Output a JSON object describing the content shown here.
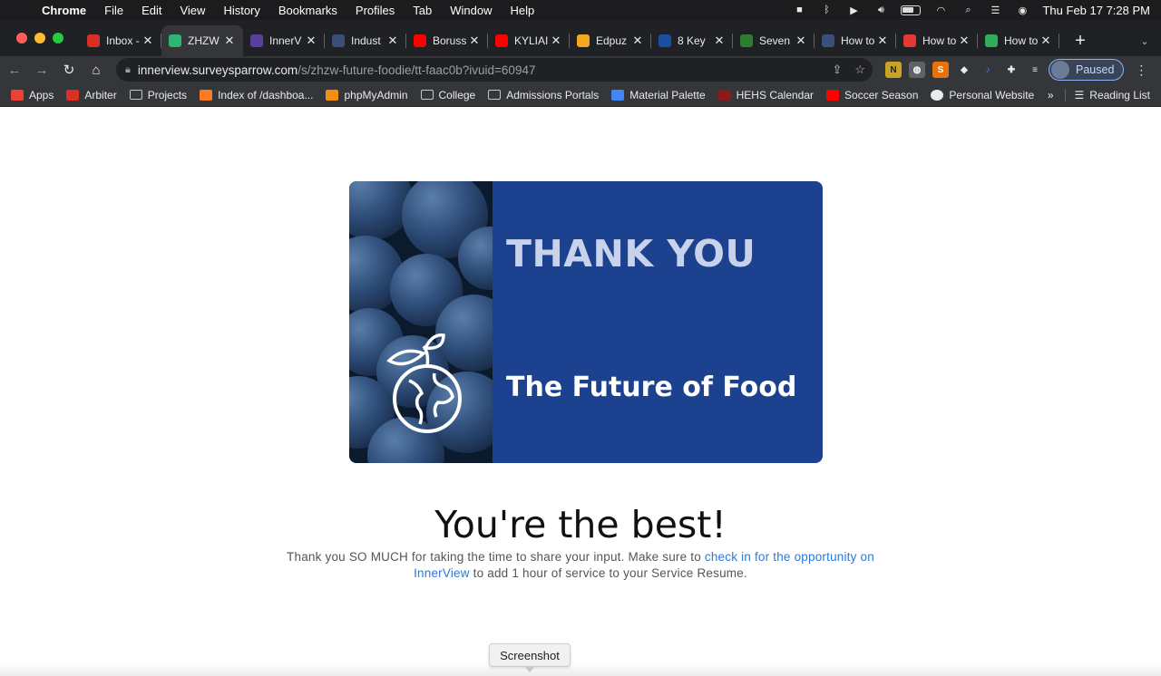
{
  "menubar": {
    "app": "Chrome",
    "items": [
      "File",
      "Edit",
      "View",
      "History",
      "Bookmarks",
      "Profiles",
      "Tab",
      "Window",
      "Help"
    ],
    "clock": "Thu Feb 17  7:28 PM"
  },
  "tabs": [
    {
      "label": "Inbox -",
      "icon": "gmail-icon",
      "color": "#d93025"
    },
    {
      "label": "ZHZW",
      "icon": "surveysparrow-icon",
      "color": "#2bb673",
      "active": true
    },
    {
      "label": "InnerV",
      "icon": "innerview-icon",
      "color": "#5b3fa0"
    },
    {
      "label": "Indust",
      "icon": "swoosh-icon",
      "color": "#3a4f7a"
    },
    {
      "label": "Boruss",
      "icon": "youtube-icon",
      "color": "#ff0000"
    },
    {
      "label": "KYLIAI",
      "icon": "youtube-icon",
      "color": "#ff0000"
    },
    {
      "label": "Edpuz",
      "icon": "edpuzzle-icon",
      "color": "#f5a623"
    },
    {
      "label": "8 Key",
      "icon": "usnews-icon",
      "color": "#1b4ea0"
    },
    {
      "label": "Seven",
      "icon": "mountain-icon",
      "color": "#2e7d32"
    },
    {
      "label": "How to",
      "icon": "swoosh-icon",
      "color": "#3a4f7a"
    },
    {
      "label": "How to",
      "icon": "wave-icon",
      "color": "#e53935"
    },
    {
      "label": "How to",
      "icon": "n-icon",
      "color": "#2fae5a"
    }
  ],
  "toolbar": {
    "url_host": "innerview.surveysparrow.com",
    "url_path": "/s/zhzw-future-foodie/tt-faac0b?ivuid=60947",
    "profile_label": "Paused"
  },
  "bookmarks": [
    {
      "label": "Apps",
      "icon": "apps-grid-icon"
    },
    {
      "label": "Arbiter",
      "icon": "arbiter-icon"
    },
    {
      "label": "Projects",
      "icon": "folder-icon"
    },
    {
      "label": "Index of /dashboa...",
      "icon": "xampp-icon"
    },
    {
      "label": "phpMyAdmin",
      "icon": "phpmyadmin-icon"
    },
    {
      "label": "College",
      "icon": "folder-icon"
    },
    {
      "label": "Admissions Portals",
      "icon": "folder-icon"
    },
    {
      "label": "Material Palette",
      "icon": "palette-icon"
    },
    {
      "label": "HEHS Calendar",
      "icon": "calendar-icon"
    },
    {
      "label": "Soccer Season",
      "icon": "youtube-icon"
    },
    {
      "label": "Personal Website",
      "icon": "globe-icon"
    }
  ],
  "reading_list": "Reading List",
  "hero": {
    "thank_you": "THANK YOU",
    "subtitle": "The Future of Food"
  },
  "headline": "You're the best!",
  "message": {
    "before": "Thank you SO MUCH for taking the time to share your input. Make sure to ",
    "link": "check in for the opportunity on InnerView",
    "after": " to add 1 hour of service to your Service Resume."
  },
  "tooltip": "Screenshot"
}
